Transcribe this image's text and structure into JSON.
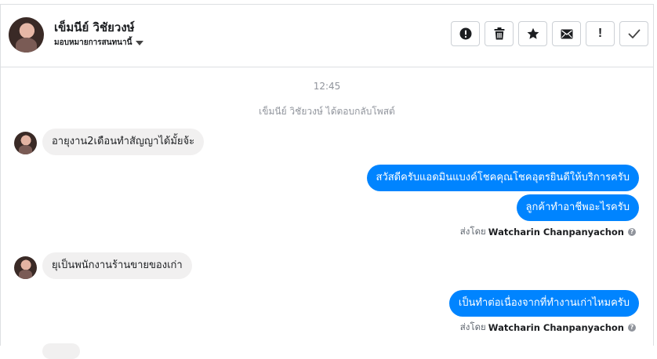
{
  "header": {
    "contact_name": "เข็มนีย์ วิชัยวงษ์",
    "assign_label": "มอบหมายการสนทนานี้",
    "actions": [
      {
        "name": "report-spam-button",
        "icon": "alert-circle-icon"
      },
      {
        "name": "delete-button",
        "icon": "trash-icon"
      },
      {
        "name": "star-button",
        "icon": "star-icon"
      },
      {
        "name": "mark-unread-button",
        "icon": "mail-icon"
      },
      {
        "name": "follow-up-button",
        "icon": "exclamation-icon",
        "glyph": "!"
      },
      {
        "name": "mark-done-button",
        "icon": "check-icon"
      }
    ]
  },
  "thread": {
    "timestamp": "12:45",
    "system_message": "เข็มนีย์ วิชัยวงษ์ ได้ตอบกลับโพสต์",
    "messages": [
      {
        "direction": "in",
        "text": "อายุงาน2เดือนทำสัญญาได้มั้ยจ้ะ"
      },
      {
        "direction": "out",
        "text": "สวัสดีครับแอดมินแบงค์โชคคุณโชคอุตรยินดีให้บริการครับ"
      },
      {
        "direction": "out",
        "text": "ลูกค้าทำอาชีพอะไรครับ"
      },
      {
        "direction": "in",
        "text": "ยุเป็นพนักงานร้านขายของเก่า"
      },
      {
        "direction": "out",
        "text": "เป็นทำต่อเนื่องจากที่ทำงานเก่าไหมครับ"
      }
    ],
    "sent_by_prefix": "ส่งโดย",
    "sent_by_name": "Watcharin Chanpanyachon",
    "help_glyph": "?"
  },
  "colors": {
    "outgoing_bubble": "#0084ff",
    "incoming_bubble": "#f1f0f0",
    "muted_text": "#90949c",
    "border": "#dddfe2"
  }
}
